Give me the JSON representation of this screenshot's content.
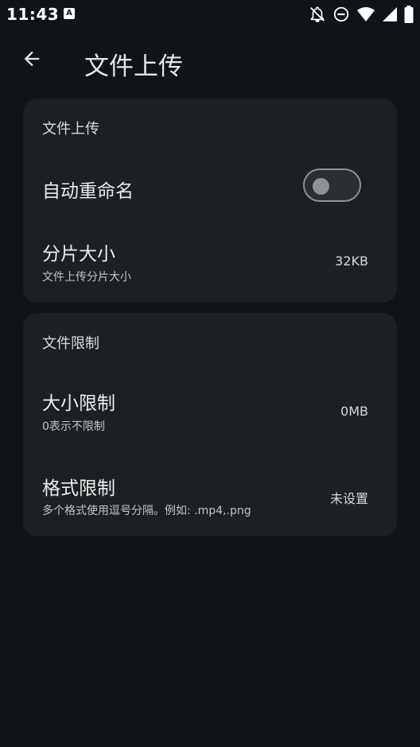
{
  "status_bar": {
    "time": "11:43",
    "a_icon_label": "A",
    "icons": [
      "notifications-off-icon",
      "do-not-disturb-icon",
      "wifi-icon",
      "cellular-signal-icon",
      "battery-icon"
    ]
  },
  "app_bar": {
    "back_icon": "arrow-back-icon",
    "title": "文件上传"
  },
  "sections": [
    {
      "header": "文件上传",
      "items": [
        {
          "title": "自动重命名",
          "toggle_on": false
        },
        {
          "title": "分片大小",
          "subtitle": "文件上传分片大小",
          "value": "32KB"
        }
      ]
    },
    {
      "header": "文件限制",
      "items": [
        {
          "title": "大小限制",
          "subtitle": "0表示不限制",
          "value": "0MB"
        },
        {
          "title": "格式限制",
          "subtitle": "多个格式使用逗号分隔。例如: .mp4,.png",
          "value": "未设置"
        }
      ]
    }
  ],
  "colors": {
    "background": "#111416",
    "card": "#1c2022",
    "switch_outline": "#8c9296"
  }
}
